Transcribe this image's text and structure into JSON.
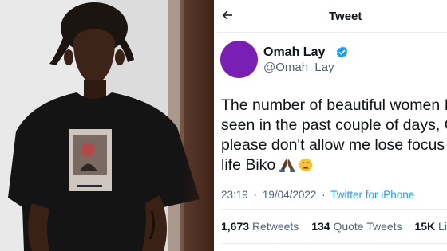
{
  "photo": {
    "description_icon": "person-portrait-photo",
    "shirt_print_icon": "shirt-graphic-print"
  },
  "header": {
    "back_icon": "back-arrow-icon",
    "title": "Tweet"
  },
  "author": {
    "display_name": "Omah Lay",
    "handle": "@Omah_Lay",
    "avatar_color": "#7a1fb4",
    "verified_icon": "verified-badge-icon",
    "verified_color": "#1d9bf0"
  },
  "tweet": {
    "text": "The number of beautiful women I've\nseen in the past couple of days, God\nplease don't allow me lose focus in\nlife Biko",
    "emojis": [
      "folded-hands-emoji",
      "weary-face-emoji"
    ],
    "time": "23:19",
    "date": "19/04/2022",
    "separator": "·",
    "source": "Twitter for iPhone"
  },
  "stats": {
    "retweets_count": "1,673",
    "retweets_label": "Retweets",
    "quote_count": "134",
    "quote_label": "Quote Tweets",
    "likes_count": "15K",
    "likes_label": "Likes"
  },
  "colors": {
    "link_blue": "#1d9bf0",
    "muted_text": "#536471",
    "text": "#0f1419"
  }
}
